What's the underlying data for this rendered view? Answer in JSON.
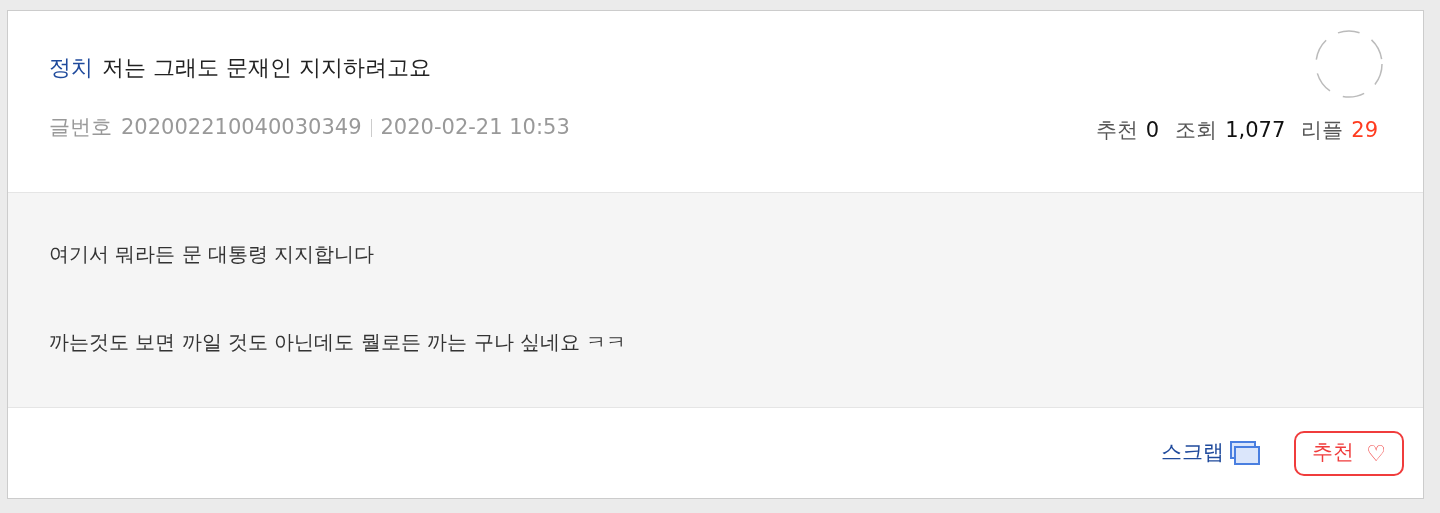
{
  "post": {
    "category": "정치",
    "title": "저는 그래도 문재인 지지하려고요",
    "meta": {
      "number_label": "글번호",
      "number": "202002210040030349",
      "date": "2020-02-21 10:53"
    },
    "stats": [
      {
        "label": "추천",
        "value": "0",
        "kind": "plain"
      },
      {
        "label": "조회",
        "value": "1,077",
        "kind": "plain"
      },
      {
        "label": "리플",
        "value": "29",
        "kind": "hot"
      }
    ],
    "body": [
      "여기서 뭐라든 문 대통령 지지합니다",
      "까는것도 보면 까일 것도 아닌데도 뭘로든 까는 구나 싶네요 ㅋㅋ"
    ],
    "actions": {
      "scrap": "스크랩",
      "recommend": "추천",
      "recommend_icon": "♡"
    }
  }
}
